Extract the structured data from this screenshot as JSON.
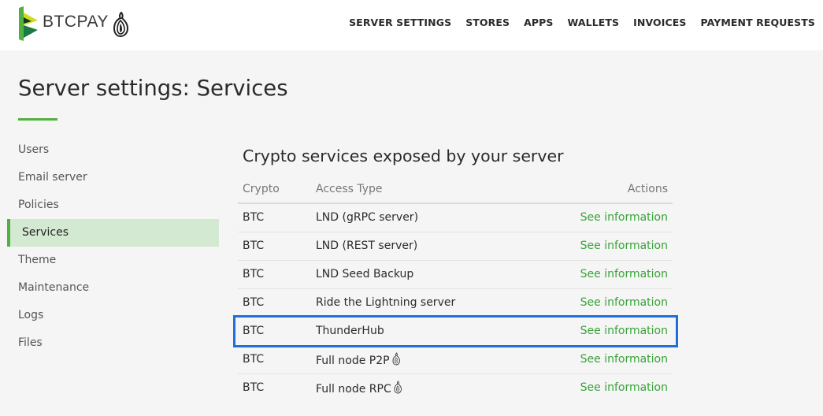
{
  "header": {
    "brand": "BTCPAY",
    "logo_icon": "btcpay-logo-icon",
    "tor_icon": "tor-onion-icon",
    "nav": [
      {
        "label": "SERVER SETTINGS"
      },
      {
        "label": "STORES"
      },
      {
        "label": "APPS"
      },
      {
        "label": "WALLETS"
      },
      {
        "label": "INVOICES"
      },
      {
        "label": "PAYMENT REQUESTS"
      }
    ]
  },
  "page": {
    "title": "Server settings: Services"
  },
  "sidebar": {
    "items": [
      {
        "label": "Users",
        "active": false
      },
      {
        "label": "Email server",
        "active": false
      },
      {
        "label": "Policies",
        "active": false
      },
      {
        "label": "Services",
        "active": true
      },
      {
        "label": "Theme",
        "active": false
      },
      {
        "label": "Maintenance",
        "active": false
      },
      {
        "label": "Logs",
        "active": false
      },
      {
        "label": "Files",
        "active": false
      }
    ]
  },
  "services": {
    "title": "Crypto services exposed by your server",
    "columns": {
      "crypto": "Crypto",
      "access_type": "Access Type",
      "actions": "Actions"
    },
    "rows": [
      {
        "crypto": "BTC",
        "access_type": "LND (gRPC server)",
        "action": "See information",
        "tor": false
      },
      {
        "crypto": "BTC",
        "access_type": "LND (REST server)",
        "action": "See information",
        "tor": false
      },
      {
        "crypto": "BTC",
        "access_type": "LND Seed Backup",
        "action": "See information",
        "tor": false
      },
      {
        "crypto": "BTC",
        "access_type": "Ride the Lightning server",
        "action": "See information",
        "tor": false
      },
      {
        "crypto": "BTC",
        "access_type": "ThunderHub",
        "action": "See information",
        "tor": false,
        "highlighted": true
      },
      {
        "crypto": "BTC",
        "access_type": "Full node P2P",
        "action": "See information",
        "tor": true
      },
      {
        "crypto": "BTC",
        "access_type": "Full node RPC",
        "action": "See information",
        "tor": true
      }
    ]
  },
  "colors": {
    "accent": "#51b13e",
    "link": "#3aa33a",
    "highlight": "#1f6fe0",
    "active_bg": "#d4e9d1"
  }
}
